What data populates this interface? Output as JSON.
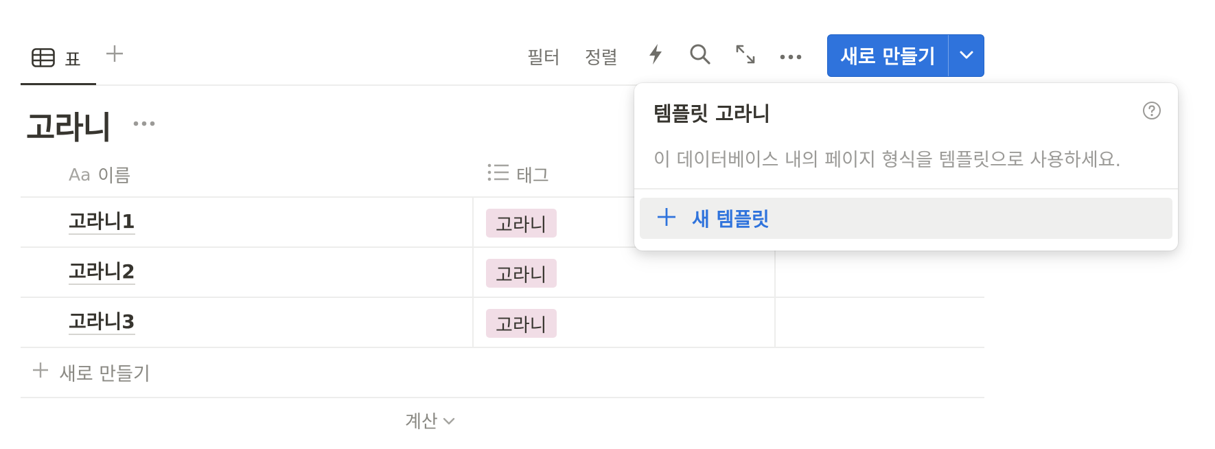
{
  "toolbar": {
    "view_tab_label": "표",
    "filter_label": "필터",
    "sort_label": "정렬",
    "new_button_label": "새로 만들기",
    "icons": [
      "table-icon",
      "plus-icon",
      "lightning-icon",
      "search-icon",
      "expand-icon",
      "more-icon",
      "chevron-down-icon"
    ]
  },
  "page": {
    "title": "고라니"
  },
  "table": {
    "columns": [
      {
        "label": "이름",
        "type_glyph": "Aa"
      },
      {
        "label": "태그"
      }
    ],
    "rows": [
      {
        "name": "고라니1",
        "tag": "고라니"
      },
      {
        "name": "고라니2",
        "tag": "고라니"
      },
      {
        "name": "고라니3",
        "tag": "고라니"
      }
    ],
    "add_row_label": "새로 만들기",
    "calculate_label": "계산"
  },
  "template_popover": {
    "title": "템플릿 고라니",
    "description": "이 데이터베이스 내의 페이지 형식을 템플릿으로 사용하세요.",
    "new_template_label": "새 템플릿"
  },
  "colors": {
    "accent": "#2f73dc",
    "tag_background": "#f1dde6",
    "text": "#37352f",
    "muted": "#8a8983"
  }
}
